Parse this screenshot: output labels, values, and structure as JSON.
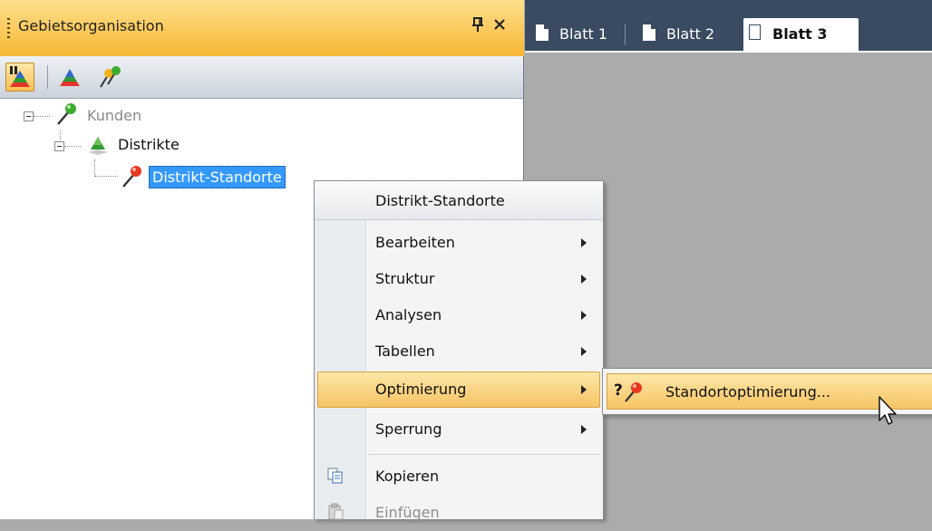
{
  "panel": {
    "title": "Gebietsorganisation",
    "pin_glyph": "q",
    "close_glyph": "✕"
  },
  "toolbar": {
    "buttons": [
      {
        "icon": "layers-pin-icon",
        "active": true
      },
      {
        "icon": "layers-icon",
        "active": false
      },
      {
        "icon": "pins-icon",
        "active": false
      }
    ]
  },
  "tree": {
    "nodes": [
      {
        "label": "Kunden",
        "icon": "green-pin-icon",
        "state": "expanded"
      },
      {
        "label": "Distrikte",
        "icon": "layer-pyramid-icon",
        "state": "expanded"
      },
      {
        "label": "Distrikt-Standorte",
        "icon": "red-pin-icon",
        "state": "selected"
      }
    ]
  },
  "tabs": [
    {
      "label": "Blatt 1",
      "active": false
    },
    {
      "label": "Blatt 2",
      "active": false
    },
    {
      "label": "Blatt 3",
      "active": true
    }
  ],
  "context_menu": {
    "title": "Distrikt-Standorte",
    "items": [
      {
        "label": "Bearbeiten",
        "submenu": true
      },
      {
        "label": "Struktur",
        "submenu": true
      },
      {
        "label": "Analysen",
        "submenu": true
      },
      {
        "label": "Tabellen",
        "submenu": true
      },
      {
        "label": "Optimierung",
        "submenu": true,
        "highlighted": true
      },
      {
        "label": "Sperrung",
        "submenu": true
      },
      {
        "label": "Kopieren",
        "icon": "copy-icon"
      },
      {
        "label": "Einfügen",
        "icon": "paste-icon",
        "disabled": true
      }
    ]
  },
  "submenu": {
    "item_label": "Standortoptimierung...",
    "icon": "question-pin-icon"
  },
  "colors": {
    "panel_header": "#f7b733",
    "tab_strip": "#3a4b61",
    "selection": "#3399ff",
    "menu_highlight": "#f6c463",
    "workspace": "#ababab"
  }
}
